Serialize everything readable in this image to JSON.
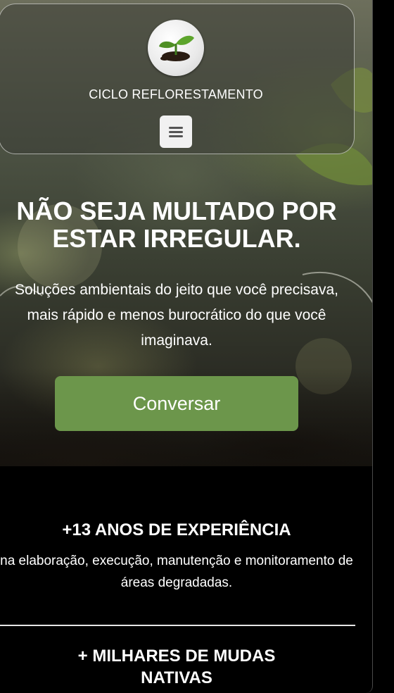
{
  "header": {
    "brand_name": "CICLO REFLORESTAMENTO",
    "logo_icon": "sprout-logo",
    "menu_icon": "hamburger-menu-icon"
  },
  "hero": {
    "headline": "NÃO SEJA MULTADO POR ESTAR IRREGULAR.",
    "subtext": "Soluções ambientais do jeito que você precisava, mais rápido e menos burocrático do que você imaginava.",
    "cta_label": "Conversar"
  },
  "stats": [
    {
      "title": "+13 ANOS DE EXPERIÊNCIA",
      "description": "na elaboração, execução, manutenção e monitoramento de áreas degradadas."
    },
    {
      "title": "+ MILHARES DE MUDAS NATIVAS"
    }
  ],
  "colors": {
    "cta_background": "#6c964b",
    "page_background": "#000000",
    "text": "#ffffff"
  }
}
